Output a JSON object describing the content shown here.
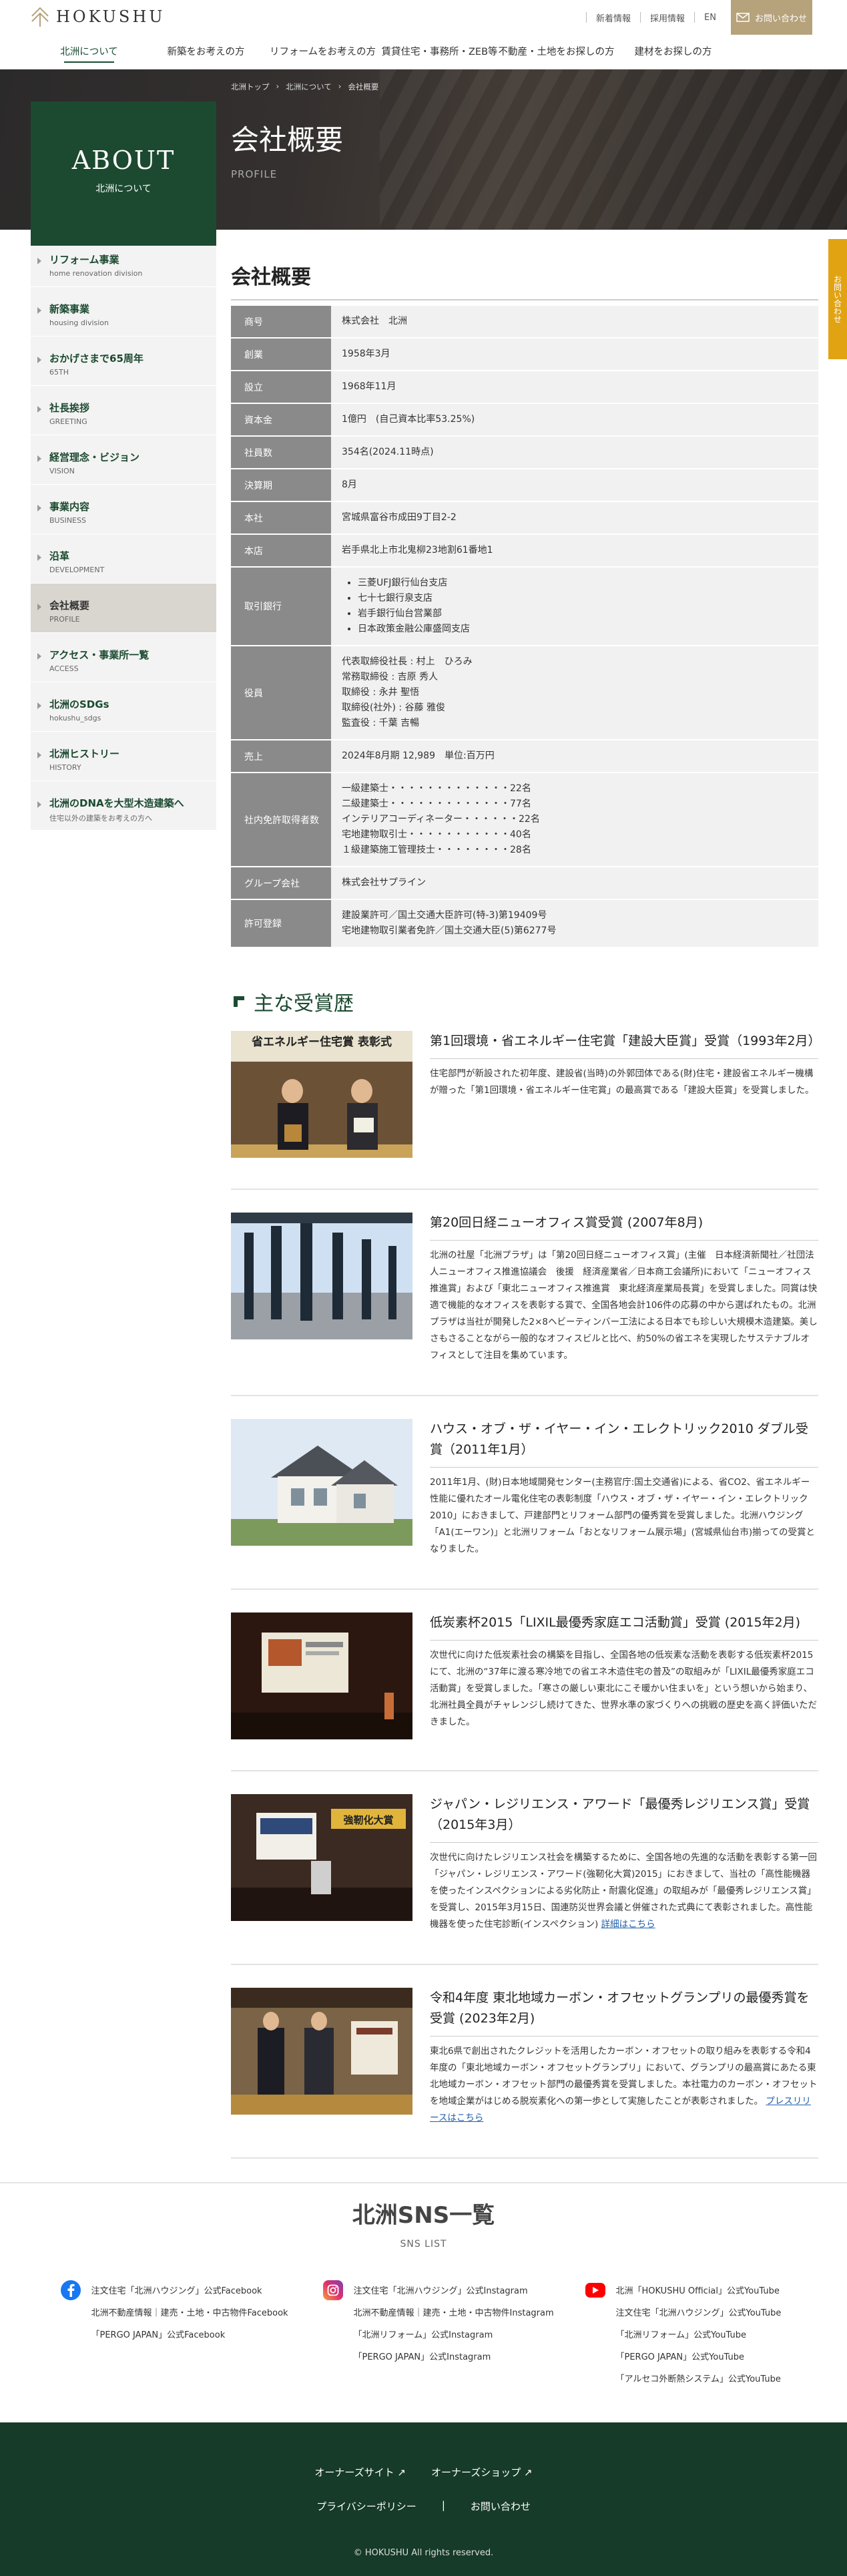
{
  "header": {
    "brand": "HOKUSHU",
    "util_links": [
      "新着情報",
      "採用情報",
      "EN"
    ],
    "contact": "お問い合わせ"
  },
  "gnav": [
    "北洲について",
    "新築をお考えの方",
    "リフォームをお考えの方",
    "賃貸住宅・事務所・ZEB等",
    "不動産・土地をお探しの方",
    "建材をお探しの方"
  ],
  "breadcrumb": [
    "北洲トップ",
    "北洲について",
    "会社概要"
  ],
  "about": {
    "en": "ABOUT",
    "ja": "北洲について"
  },
  "page": {
    "title": "会社概要",
    "subtitle": "PROFILE"
  },
  "side_tab": "お問い合わせ",
  "sidebar": [
    {
      "ja": "リフォーム事業",
      "en": "home renovation division"
    },
    {
      "ja": "新築事業",
      "en": "housing division"
    },
    {
      "ja": "おかげさまで65周年",
      "en": "65TH"
    },
    {
      "ja": "社長挨拶",
      "en": "GREETING"
    },
    {
      "ja": "経営理念・ビジョン",
      "en": "VISION"
    },
    {
      "ja": "事業内容",
      "en": "BUSINESS"
    },
    {
      "ja": "沿革",
      "en": "DEVELOPMENT"
    },
    {
      "ja": "会社概要",
      "en": "PROFILE"
    },
    {
      "ja": "アクセス・事業所一覧",
      "en": "ACCESS"
    },
    {
      "ja": "北洲のSDGs",
      "en": "hokushu_sdgs"
    },
    {
      "ja": "北洲ヒストリー",
      "en": "HISTORY"
    },
    {
      "ja": "北洲のDNAを大型木造建築へ",
      "en": "住宅以外の建築をお考えの方へ"
    }
  ],
  "profile": {
    "heading": "会社概要",
    "rows": [
      {
        "label": "商号",
        "value": "株式会社　北洲"
      },
      {
        "label": "創業",
        "value": "1958年3月"
      },
      {
        "label": "設立",
        "value": "1968年11月"
      },
      {
        "label": "資本金",
        "value": "1億円　(自己資本比率53.25%)"
      },
      {
        "label": "社員数",
        "value": "354名(2024.11時点)"
      },
      {
        "label": "決算期",
        "value": "8月"
      },
      {
        "label": "本社",
        "value": "宮城県富谷市成田9丁目2-2"
      },
      {
        "label": "本店",
        "value": "岩手県北上市北鬼柳23地割61番地1"
      },
      {
        "label": "取引銀行",
        "list": [
          "三菱UFJ銀行仙台支店",
          "七十七銀行泉支店",
          "岩手銀行仙台営業部",
          "日本政策金融公庫盛岡支店"
        ]
      },
      {
        "label": "役員",
        "lines": [
          "代表取締役社長 : 村上　ひろみ",
          "常務取締役 : 吉原 秀人",
          "取締役 : 永井 聖悟",
          "取締役(社外) : 谷藤 雅俊",
          "監査役 : 千葉 吉暢"
        ]
      },
      {
        "label": "売上",
        "value": "2024年8月期  12,989　単位:百万円"
      },
      {
        "label": "社内免許取得者数",
        "lines": [
          "一級建築士・・・・・・・・・・・・・22名",
          "二級建築士・・・・・・・・・・・・・77名",
          "インテリアコーディネーター・・・・・・22名",
          "宅地建物取引士・・・・・・・・・・・40名",
          "１級建築施工管理技士・・・・・・・・28名"
        ]
      },
      {
        "label": "グループ会社",
        "value": "株式会社サプライン"
      },
      {
        "label": "許可登録",
        "lines": [
          "建設業許可／国土交通大臣許可(特-3)第19409号",
          "宅地建物取引業者免許／国土交通大臣(5)第6277号"
        ]
      }
    ]
  },
  "awards": {
    "heading": "主な受賞歴",
    "items": [
      {
        "title": "第1回環境・省エネルギー住宅賞「建設大臣賞」受賞（1993年2月）",
        "text": "住宅部門が新設された初年度、建設省(当時)の外郭団体である(財)住宅・建設省エネルギー機構が贈った「第1回環境・省エネルギー住宅賞」の最高賞である「建設大臣賞」を受賞しました。",
        "photo_caption": "省エネルギー住宅賞 表彰式",
        "link": ""
      },
      {
        "title": "第20回日経ニューオフィス賞受賞 (2007年8月)",
        "text": "北洲の社屋「北洲プラザ」は「第20回日経ニューオフィス賞」(主催　日本経済新聞社／社団法人ニューオフィス推進協議会　後援　経済産業省／日本商工会議所)において「ニューオフィス推進賞」および「東北ニューオフィス推進賞　東北経済産業局長賞」を受賞しました。同賞は快適で機能的なオフィスを表彰する賞で、全国各地会計106件の応募の中から選ばれたもの。北洲プラザは当社が開発した2×8ヘビーティンバー工法による日本でも珍しい大規模木造建築。美しさもさることながら一般的なオフィスビルと比べ、約50%の省エネを実現したサステナブルオフィスとして注目を集めています。",
        "photo_caption": "",
        "link": ""
      },
      {
        "title": "ハウス・オブ・ザ・イヤー・イン・エレクトリック2010 ダブル受賞（2011年1月）",
        "text": "2011年1月、(財)日本地域開発センター(主務官庁:国土交通省)による、省CO2、省エネルギー性能に優れたオール電化住宅の表彰制度「ハウス・オブ・ザ・イヤー・イン・エレクトリック2010」におきまして、戸建部門とリフォーム部門の優秀賞を受賞しました。北洲ハウジング「A1(エーワン)」と北洲リフォーム「おとなリフォーム展示場」(宮城県仙台市)揃っての受賞となりました。",
        "photo_caption": "",
        "link": ""
      },
      {
        "title": "低炭素杯2015「LIXIL最優秀家庭エコ活動賞」受賞 (2015年2月)",
        "text": "次世代に向けた低炭素社会の構築を目指し、全国各地の低炭素な活動を表彰する低炭素杯2015にて、北洲の“37年に渡る寒冷地での省エネ木造住宅の普及”の取組みが「LIXIL最優秀家庭エコ活動賞」を受賞しました。「寒さの厳しい東北にこそ暖かい住まいを」という想いから始まり、北洲社員全員がチャレンジし続けてきた、世界水準の家づくりへの挑戦の歴史を高く評価いただきました。",
        "photo_caption": "",
        "link": ""
      },
      {
        "title": "ジャパン・レジリエンス・アワード「最優秀レジリエンス賞」受賞（2015年3月）",
        "text": "次世代に向けたレジリエンス社会を構築するために、全国各地の先進的な活動を表彰する第一回「ジャパン・レジリエンス・アワード(強靭化大賞)2015」におきまして、当社の「高性能機器を使ったインスペクションによる劣化防止・耐震化促進」の取組みが「最優秀レジリエンス賞」を受賞し、2015年3月15日、国連防災世界会議と併催された式典にて表彰されました。高性能機器を使った住宅診断(インスペクション)",
        "photo_caption": "強靭化大賞",
        "link": "詳細はこちら"
      },
      {
        "title": "令和4年度 東北地域カーボン・オフセットグランプリの最優秀賞を受賞 (2023年2月)",
        "text": "東北6県で創出されたクレジットを活用したカーボン・オフセットの取り組みを表彰する令和4年度の「東北地域カーボン・オフセットグランプリ」において、グランプリの最高賞にあたる東北地域カーボン・オフセット部門の最優秀賞を受賞しました。本社電力のカーボン・オフセット　を地域企業がはじめる脱炭素化への第一歩として実施したことが表彰されました。",
        "photo_caption": "",
        "link": "プレスリリースはこちら"
      }
    ]
  },
  "sns": {
    "title": "北洲SNS一覧",
    "subtitle": "SNS LIST",
    "facebook": [
      "注文住宅「北洲ハウジング」公式Facebook",
      "北洲不動産情報｜建売・土地・中古物件Facebook",
      "「PERGO JAPAN」公式Facebook"
    ],
    "instagram": [
      "注文住宅「北洲ハウジング」公式Instagram",
      "北洲不動産情報｜建売・土地・中古物件Instagram",
      "「北洲リフォーム」公式Instagram",
      "「PERGO JAPAN」公式Instagram"
    ],
    "youtube": [
      "北洲「HOKUSHU Official」公式YouTube",
      "注文住宅「北洲ハウジング」公式YouTube",
      "「北洲リフォーム」公式YouTube",
      "「PERGO JAPAN」公式YouTube",
      "「アルセコ外断熱システム」公式YouTube"
    ]
  },
  "footer": {
    "links1": [
      "オーナーズサイト",
      "オーナーズショップ"
    ],
    "links2": [
      "プライバシーポリシー",
      "お問い合わせ"
    ],
    "copyright": "© HOKUSHU All rights reserved."
  },
  "colors": {
    "brand_green": "#1c4a30",
    "gold": "#b6a27b",
    "side_tab": "#e2a313"
  }
}
